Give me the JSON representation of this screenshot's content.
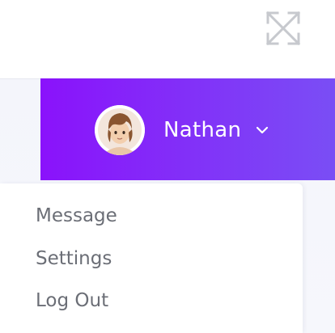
{
  "header": {
    "fullscreen_icon": "expand-arrows-icon",
    "accent_gradient": [
      "#8a12fb",
      "#7a4ef5"
    ]
  },
  "user": {
    "name": "Nathan",
    "avatar": "user-avatar-cartoon",
    "dropdown_icon": "chevron-down-icon"
  },
  "menu": {
    "items": [
      {
        "label": "Message"
      },
      {
        "label": "Settings"
      },
      {
        "label": "Log Out"
      }
    ]
  }
}
